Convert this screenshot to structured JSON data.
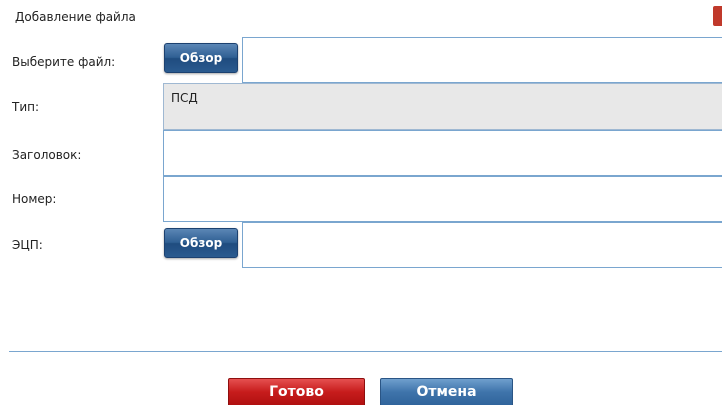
{
  "dialog": {
    "title": "Добавление файла"
  },
  "form": {
    "file_label": "Выберите файл:",
    "type_label": "Тип:",
    "type_value": "ПСД",
    "heading_label": "Заголовок:",
    "number_label": "Номер:",
    "signature_label": "ЭЦП:",
    "browse_label": "Обзор"
  },
  "actions": {
    "done_label": "Готово",
    "cancel_label": "Отмена"
  },
  "colors": {
    "accent_blue": "#2f5f93",
    "accent_red": "#c71c1c",
    "field_border": "#7aa6cf"
  }
}
